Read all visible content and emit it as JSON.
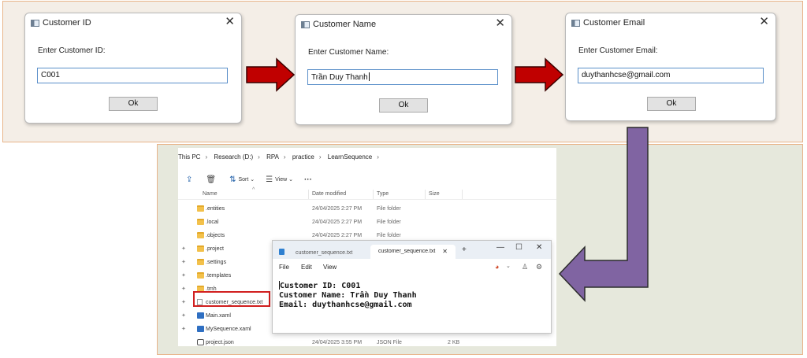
{
  "dialogs": {
    "id": {
      "title": "Customer ID",
      "close": "✕",
      "prompt": "Enter Customer ID:",
      "value": "C001",
      "ok": "Ok"
    },
    "name": {
      "title": "Customer Name",
      "close": "✕",
      "prompt": "Enter Customer Name:",
      "value": "Trần Duy Thanh",
      "ok": "Ok"
    },
    "email": {
      "title": "Customer Email",
      "close": "✕",
      "prompt": "Enter Customer Email:",
      "value": "duythanhcse@gmail.com",
      "ok": "Ok"
    }
  },
  "arrows": {
    "red_color": "#c00000",
    "purple_color": "#8064a2"
  },
  "explorer": {
    "breadcrumb": [
      "This PC",
      "Research (D:)",
      "RPA",
      "practice",
      "LearnSequence"
    ],
    "breadcrumb_sep": "›",
    "toolbar": {
      "sort": "Sort",
      "view": "View",
      "more": "···"
    },
    "columns": {
      "name": "Name",
      "date": "Date modified",
      "type": "Type",
      "size": "Size"
    },
    "rows": [
      {
        "name": ".entities",
        "date": "24/04/2025 2:27 PM",
        "type": "File folder",
        "size": ""
      },
      {
        "name": ".local",
        "date": "24/04/2025 2:27 PM",
        "type": "File folder",
        "size": ""
      },
      {
        "name": ".objects",
        "date": "24/04/2025 2:27 PM",
        "type": "File folder",
        "size": ""
      },
      {
        "name": ".project",
        "date": "",
        "type": "",
        "size": ""
      },
      {
        "name": ".settings",
        "date": "",
        "type": "",
        "size": ""
      },
      {
        "name": ".templates",
        "date": "",
        "type": "",
        "size": ""
      },
      {
        "name": ".tmh",
        "date": "",
        "type": "",
        "size": ""
      },
      {
        "name": "customer_sequence.txt",
        "date": "",
        "type": "",
        "size": ""
      },
      {
        "name": "Main.xaml",
        "date": "",
        "type": "",
        "size": ""
      },
      {
        "name": "MySequence.xaml",
        "date": "",
        "type": "",
        "size": ""
      },
      {
        "name": "project.json",
        "date": "24/04/2025 3:55 PM",
        "type": "JSON File",
        "size": "2 KB"
      }
    ]
  },
  "notepad": {
    "tab1": "customer_sequence.txt",
    "tab2": "customer_sequence.txt",
    "tab_close": "✕",
    "new_tab": "+",
    "win": {
      "minimize": "—",
      "maximize": "☐",
      "close": "✕"
    },
    "menu": {
      "file": "File",
      "edit": "Edit",
      "view": "View"
    },
    "line1": "Customer ID: C001",
    "line2": "Customer Name: Trần Duy Thanh",
    "line3": "Email: duythanhcse@gmail.com"
  }
}
